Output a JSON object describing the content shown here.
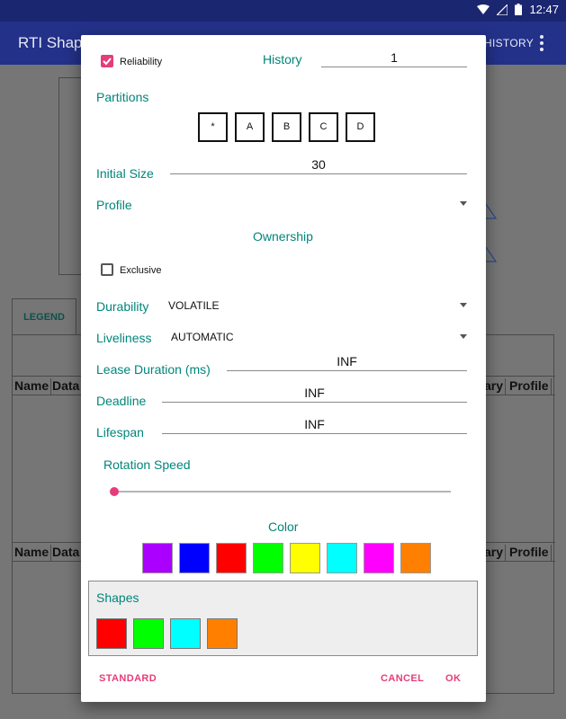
{
  "status_bar": {
    "time": "12:47"
  },
  "app_bar": {
    "title": "RTI Shapes",
    "history_label": "HISTORY"
  },
  "background": {
    "legend_tab": "LEGEND",
    "table1_headers": [
      "Name",
      "Data",
      "ary",
      "Profile"
    ],
    "table2_headers": [
      "Name",
      "Data",
      "ary",
      "Profile"
    ]
  },
  "dialog": {
    "reliability": {
      "label": "Reliability",
      "checked": true
    },
    "history": {
      "label": "History",
      "value": "1"
    },
    "partitions": {
      "label": "Partitions",
      "items": [
        "*",
        "A",
        "B",
        "C",
        "D"
      ]
    },
    "initial_size": {
      "label": "Initial Size",
      "value": "30"
    },
    "profile": {
      "label": "Profile",
      "value": ""
    },
    "ownership": {
      "label": "Ownership"
    },
    "exclusive": {
      "label": "Exclusive",
      "checked": false
    },
    "durability": {
      "label": "Durability",
      "value": "VOLATILE"
    },
    "liveliness": {
      "label": "Liveliness",
      "value": "AUTOMATIC"
    },
    "lease_duration": {
      "label": "Lease Duration (ms)",
      "value": "INF"
    },
    "deadline": {
      "label": "Deadline",
      "value": "INF"
    },
    "lifespan": {
      "label": "Lifespan",
      "value": "INF"
    },
    "rotation_speed": {
      "label": "Rotation Speed",
      "value": 0
    },
    "color": {
      "label": "Color",
      "swatches": [
        "#aa00ff",
        "#0000ff",
        "#ff0000",
        "#00ff00",
        "#ffff00",
        "#00ffff",
        "#ff00ff",
        "#ff8000"
      ]
    },
    "shapes": {
      "label": "Shapes",
      "swatches": [
        "#ff0000",
        "#00ff00",
        "#00ffff",
        "#ff8000"
      ]
    },
    "actions": {
      "standard": "STANDARD",
      "cancel": "CANCEL",
      "ok": "OK"
    }
  },
  "colors": {
    "accent": "#e53d7a",
    "label_teal": "#00867a",
    "app_bar": "#233189"
  }
}
